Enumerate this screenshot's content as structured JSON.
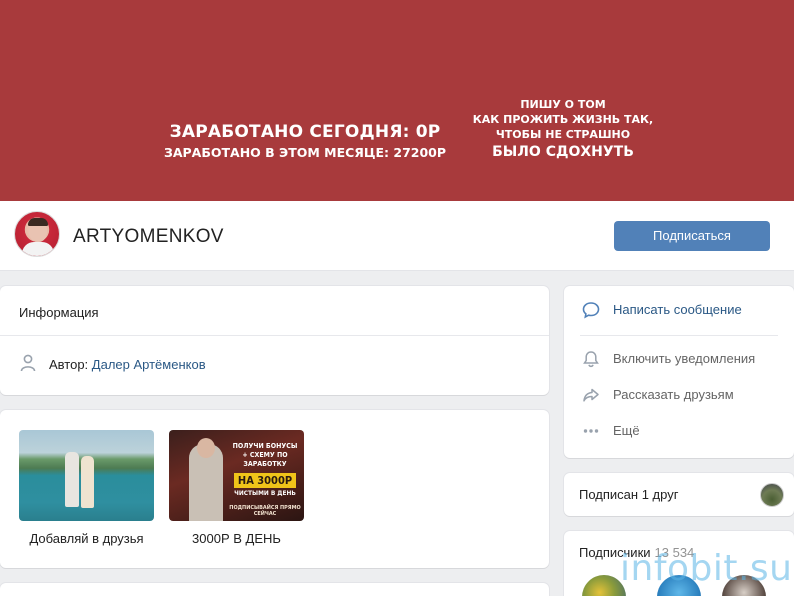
{
  "cover": {
    "left_line1": "ЗАРАБОТАНО СЕГОДНЯ: 0Р",
    "left_line2": "ЗАРАБОТАНО В ЭТОМ МЕСЯЦЕ: 27200Р",
    "right_line1": "ПИШУ О ТОМ",
    "right_line2": "КАК ПРОЖИТЬ ЖИЗНЬ ТАК,",
    "right_line3": "ЧТОБЫ НЕ СТРАШНО",
    "right_line4": "БЫЛО СДОХНУТЬ",
    "background_color": "#a83a3c"
  },
  "profile": {
    "name": "ARTYOMENKOV",
    "subscribe_label": "Подписаться"
  },
  "info": {
    "title": "Информация",
    "author_prefix": "Автор:",
    "author_name": "Далер Артёменков"
  },
  "albums": [
    {
      "label": "Добавляй в друзья"
    },
    {
      "label": "3000Р В ДЕНЬ",
      "promo_line1": "ПОЛУЧИ БОНУСЫ",
      "promo_line2": "+ СХЕМУ ПО ЗАРАБОТКУ",
      "promo_highlight": "НА 3000Р",
      "promo_line3": "ЧИСТЫМИ В ДЕНЬ",
      "promo_footer": "ПОДПИСЫВАЙСЯ ПРЯМО СЕЙЧАС"
    }
  ],
  "actions": [
    {
      "label": "Написать сообщение",
      "icon": "chat-bubble-icon"
    },
    {
      "label": "Включить уведомления",
      "icon": "bell-icon"
    },
    {
      "label": "Рассказать друзьям",
      "icon": "share-arrow-icon"
    },
    {
      "label": "Ещё",
      "icon": "more-dots-icon"
    }
  ],
  "friends": {
    "label": "Подписан 1 друг"
  },
  "subscribers": {
    "label": "Подписчики",
    "count": "13 534"
  },
  "watermark": "infobit.su",
  "colors": {
    "accent": "#5181b8",
    "link": "#2a5885",
    "page_bg": "#edeef0"
  }
}
